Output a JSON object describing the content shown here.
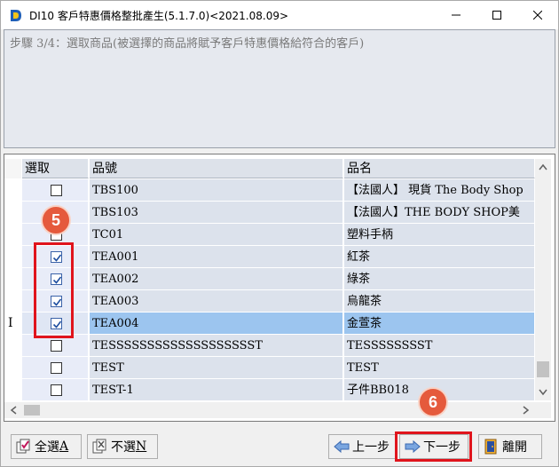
{
  "window": {
    "title": "DI10 客戶特惠價格整批產生(5.1.7.0)<2021.08.09>",
    "icon": "app-logo-icon"
  },
  "step": {
    "text": "步驟 3/4：選取商品(被選擇的商品將賦予客戶特惠價格給符合的客戶)"
  },
  "grid": {
    "columns": [
      "選取",
      "品號",
      "品名"
    ],
    "current_row_marker": "I",
    "rows": [
      {
        "checked": false,
        "code": "TBS100",
        "name": "【法國人】 現貨 The Body Shop"
      },
      {
        "checked": false,
        "code": "TBS103",
        "name": "【法國人】THE BODY SHOP美"
      },
      {
        "checked": false,
        "code": "TC01",
        "name": "塑料手柄"
      },
      {
        "checked": true,
        "code": "TEA001",
        "name": "紅茶"
      },
      {
        "checked": true,
        "code": "TEA002",
        "name": "綠茶"
      },
      {
        "checked": true,
        "code": "TEA003",
        "name": "烏龍茶"
      },
      {
        "checked": true,
        "code": "TEA004",
        "name": "金萱茶",
        "selected": true
      },
      {
        "checked": false,
        "code": "TESSSSSSSSSSSSSSSSSSST",
        "name": "TESSSSSSSST"
      },
      {
        "checked": false,
        "code": "TEST",
        "name": "TEST"
      },
      {
        "checked": false,
        "code": "TEST-1",
        "name": "子件BB018"
      }
    ]
  },
  "buttons": {
    "select_all": {
      "label": "全選",
      "hotkey": "A"
    },
    "select_none": {
      "label": "不選",
      "hotkey": "N"
    },
    "prev": {
      "label": "上一步"
    },
    "next": {
      "label": "下一步"
    },
    "exit": {
      "label": "離開"
    }
  },
  "annotations": {
    "badge_5": "5",
    "badge_6": "6",
    "highlight_color": "#e0141c",
    "badge_color": "#e55a3c"
  }
}
